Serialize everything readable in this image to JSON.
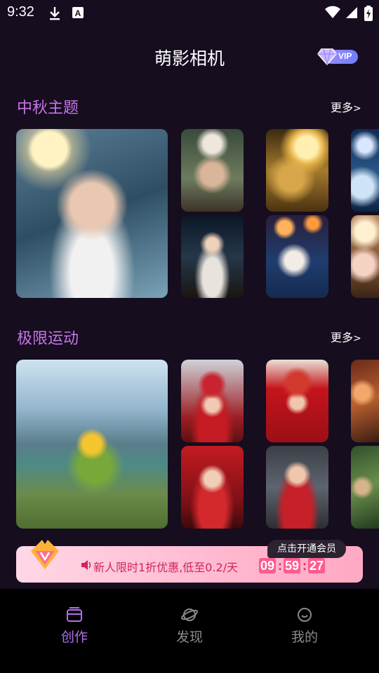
{
  "status": {
    "time": "9:32",
    "icons": [
      "download-icon",
      "text-a-icon",
      "wifi-icon",
      "signal-icon",
      "battery-icon"
    ]
  },
  "header": {
    "title": "萌影相机",
    "vip_label": "VIP"
  },
  "sections": [
    {
      "title": "中秋主题",
      "more": "更多",
      "items": [
        {
          "name": "girl-with-rabbits-under-moon"
        },
        {
          "name": "baby-with-mooncake"
        },
        {
          "name": "boy-with-golden-dragon"
        },
        {
          "name": "child-with-white-rabbit"
        },
        {
          "name": "woman-holding-rabbit"
        },
        {
          "name": "baby-with-lanterns"
        },
        {
          "name": "girl-in-moonlight"
        }
      ]
    },
    {
      "title": "极限运动",
      "more": "更多",
      "items": [
        {
          "name": "child-paragliding"
        },
        {
          "name": "child-in-race-car"
        },
        {
          "name": "child-in-formula-car"
        },
        {
          "name": "girl-in-race-car"
        },
        {
          "name": "girl-in-red-race-car"
        },
        {
          "name": "child-firefighter"
        },
        {
          "name": "child-in-jungle"
        }
      ]
    }
  ],
  "promo": {
    "text": "新人限时1折优惠,低至0.2/天",
    "tag": "点击开通会员",
    "timer": {
      "hours": "09",
      "minutes": "59",
      "seconds": "27"
    },
    "accent": "#ff5a90"
  },
  "tabs": [
    {
      "label": "创作",
      "icon": "create-icon",
      "active": true
    },
    {
      "label": "发现",
      "icon": "discover-icon",
      "active": false
    },
    {
      "label": "我的",
      "icon": "profile-icon",
      "active": false
    }
  ],
  "colors": {
    "background": "#160d1f",
    "section_title": "#c774e8",
    "active_tab": "#b56ef0",
    "inactive_tab": "#8a8a8a"
  }
}
